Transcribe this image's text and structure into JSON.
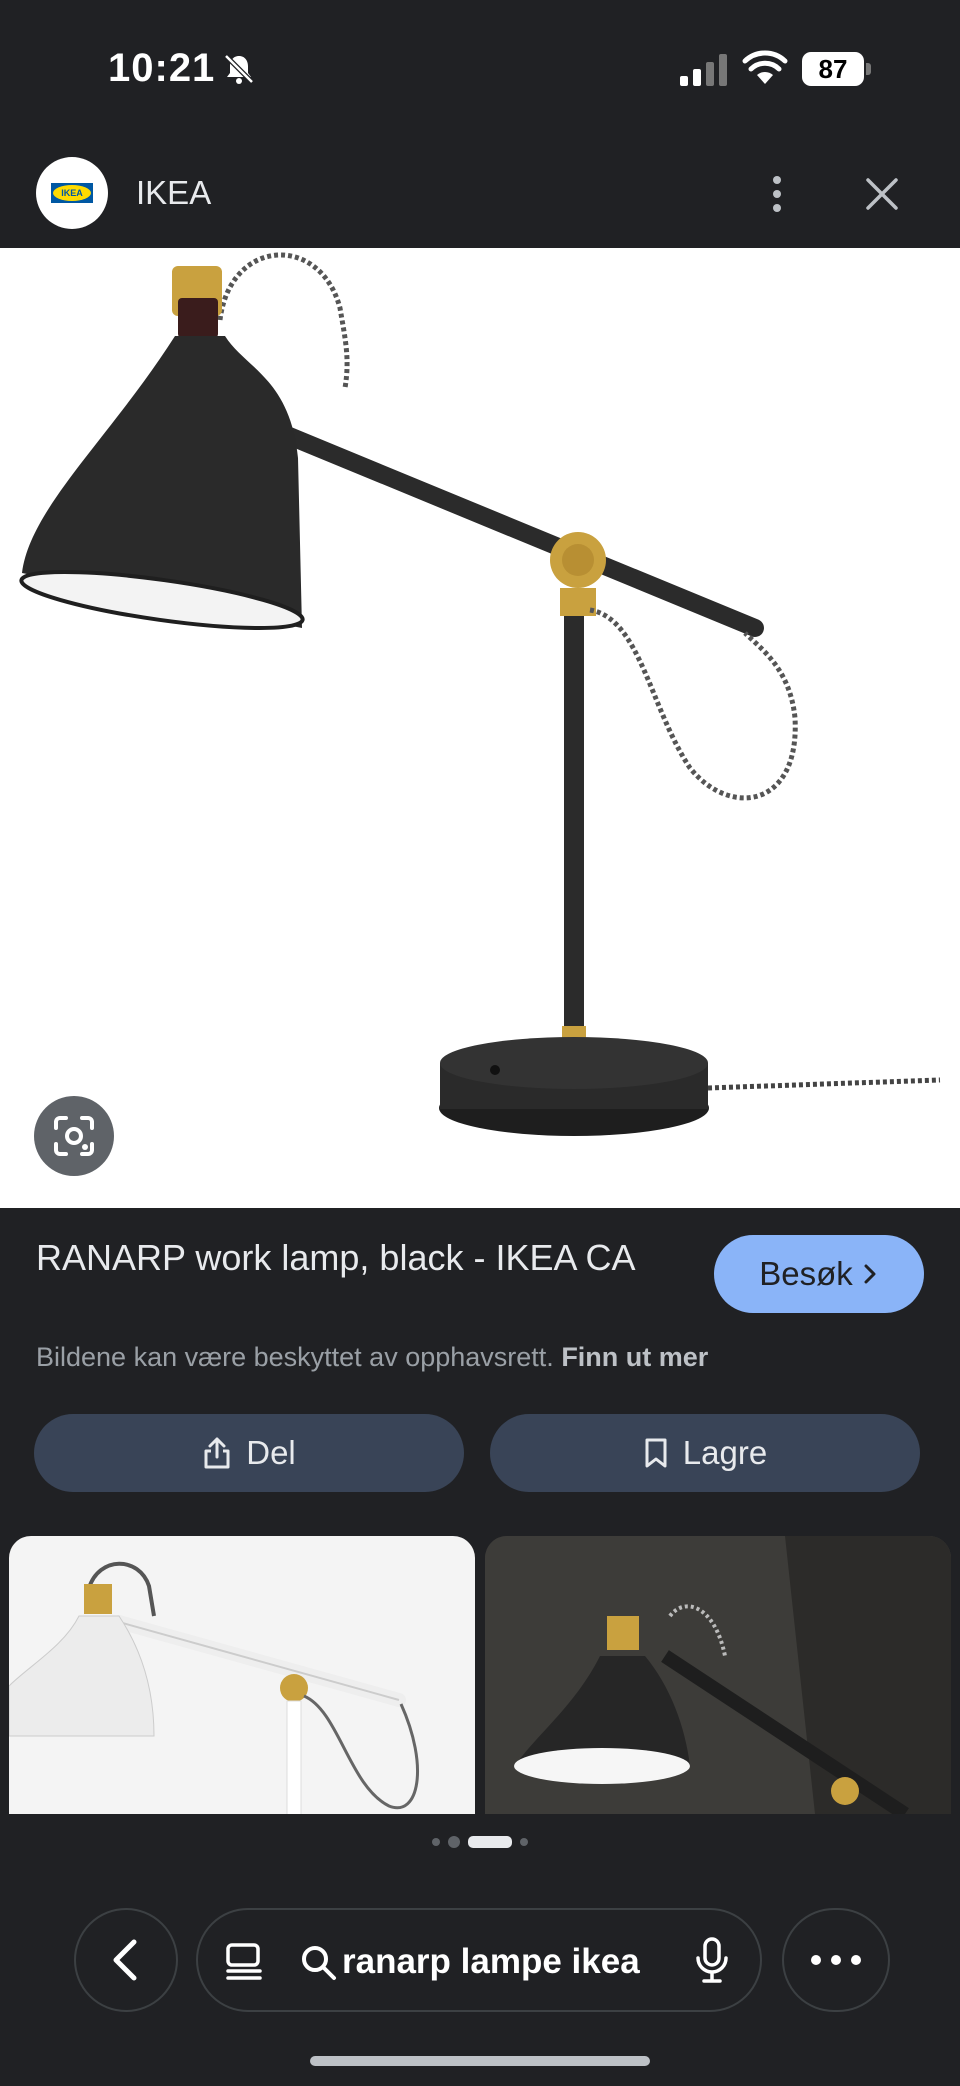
{
  "status": {
    "time": "10:21",
    "battery": "87",
    "icons": [
      "bell-slash-icon",
      "signal-icon",
      "wifi-icon",
      "battery-icon"
    ]
  },
  "header": {
    "site_name": "IKEA",
    "logo_text": "IKEA",
    "icons": [
      "ikea-logo",
      "more-vert-icon",
      "close-icon"
    ]
  },
  "result": {
    "title": "RANARP work lamp, black - IKEA CA",
    "visit_label": "Besøk",
    "copyright_text": "Bildene kan være beskyttet av opphavsrett.",
    "learn_more": "Finn ut mer",
    "share_label": "Del",
    "save_label": "Lagre"
  },
  "carousel": {
    "pages": 4,
    "active": 2
  },
  "search": {
    "query": "ranarp lampe ikea"
  },
  "colors": {
    "background": "#202124",
    "accent": "#8ab4f8",
    "action": "#394457"
  }
}
